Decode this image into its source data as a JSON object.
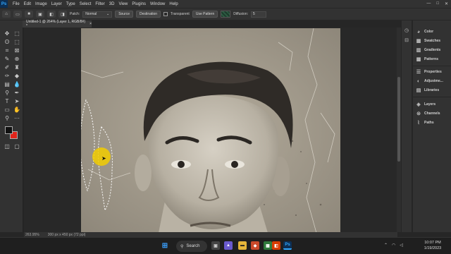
{
  "menubar": {
    "logo": "Ps",
    "items": [
      "File",
      "Edit",
      "Image",
      "Layer",
      "Type",
      "Select",
      "Filter",
      "3D",
      "View",
      "Plugins",
      "Window",
      "Help"
    ],
    "window_controls": [
      "—",
      "□",
      "✕"
    ]
  },
  "options": {
    "patch_label": "Patch:",
    "patch_value": "Normal",
    "source_label": "Source",
    "destination_label": "Destination",
    "transparent_label": "Transparent",
    "use_pattern_label": "Use Pattern",
    "diffusion_label": "Diffusion:",
    "diffusion_value": "5"
  },
  "document": {
    "tab_title": "Untitled-1 @ 264% (Layer 1, RGB/8#) *",
    "tab_close": "×"
  },
  "status": {
    "zoom": "263.95%",
    "dimensions": "300 px x 450 px (72 ppi)"
  },
  "colors": {
    "foreground": "#111111",
    "background": "#e0241b",
    "cursor_highlight": "#f2cc00"
  },
  "panels": {
    "group1": [
      {
        "icon": "color-wheel-icon",
        "label": "Color"
      },
      {
        "icon": "swatches-icon",
        "label": "Swatches"
      },
      {
        "icon": "gradients-icon",
        "label": "Gradients"
      },
      {
        "icon": "patterns-icon",
        "label": "Patterns"
      }
    ],
    "group2": [
      {
        "icon": "properties-icon",
        "label": "Properties"
      },
      {
        "icon": "adjustments-icon",
        "label": "Adjustme..."
      },
      {
        "icon": "libraries-icon",
        "label": "Libraries"
      }
    ],
    "group3": [
      {
        "icon": "layers-icon",
        "label": "Layers"
      },
      {
        "icon": "channels-icon",
        "label": "Channels"
      },
      {
        "icon": "paths-icon",
        "label": "Paths"
      }
    ]
  },
  "taskbar": {
    "search_label": "Search",
    "ps_label": "Ps",
    "clock_time": "10:07 PM",
    "clock_date": "1/19/2023"
  }
}
